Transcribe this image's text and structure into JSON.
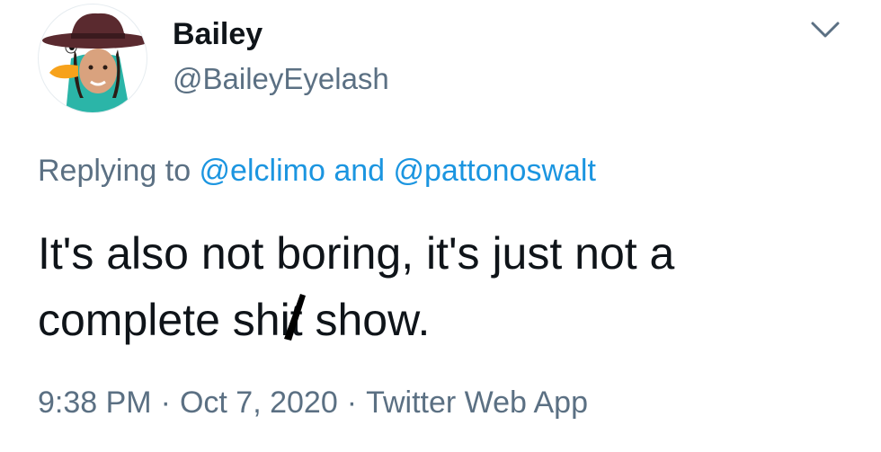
{
  "author": {
    "display_name": "Bailey",
    "handle": "@BaileyEyelash",
    "avatar": "avatar-perry-platypus-costume"
  },
  "menu": {
    "icon": "chevron-down-icon"
  },
  "reply": {
    "prefix": "Replying to ",
    "mention_1": "@elclimo",
    "conjunction": " and ",
    "mention_2": "@pattonoswalt"
  },
  "tweet": {
    "line_1": "It's also not boring, it's just not a",
    "line_2_before": "complete sh",
    "line_2_censored": "it",
    "line_2_after": " show."
  },
  "meta": {
    "time": "9:38 PM",
    "separator": "·",
    "date": "Oct 7, 2020",
    "source": "Twitter Web App"
  },
  "colors": {
    "text": "#0f1419",
    "secondary": "#5b7083",
    "link": "#1b95e0",
    "avatar_body": "#2bb5a8",
    "avatar_hat": "#5a2a2f",
    "avatar_bill": "#f7a21b"
  }
}
